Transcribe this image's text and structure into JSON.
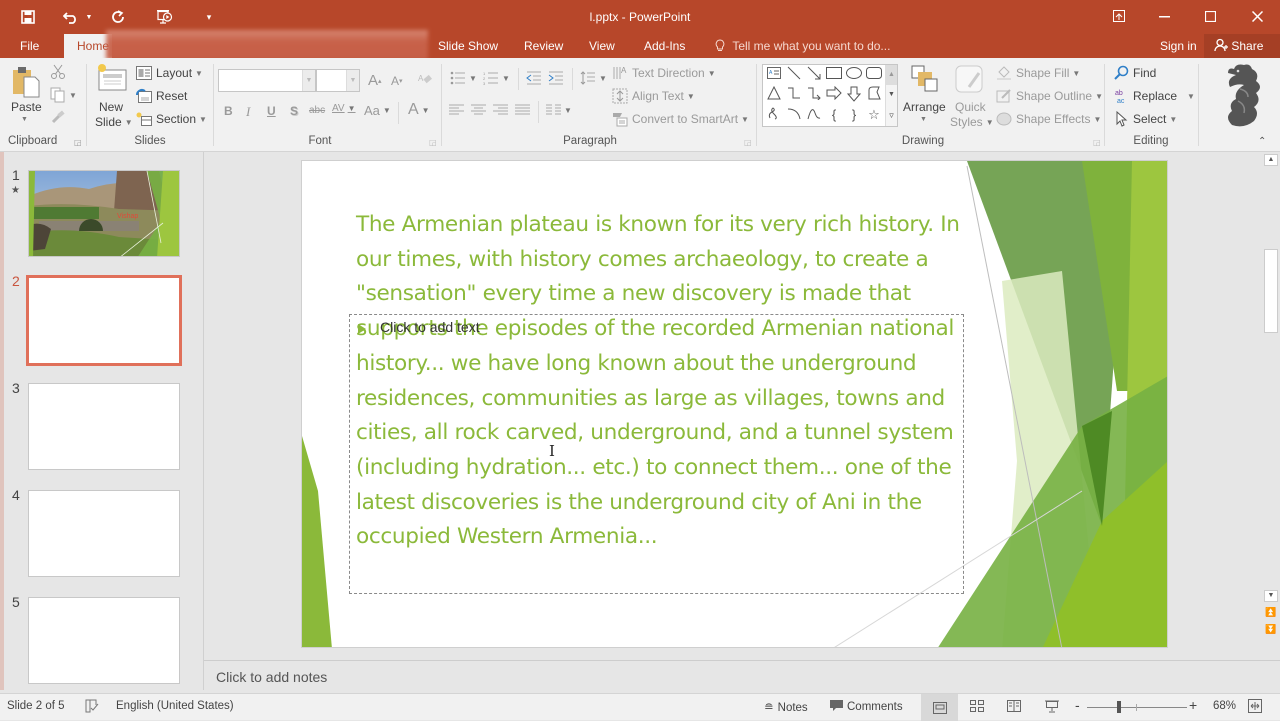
{
  "window": {
    "title": "l.pptx - PowerPoint",
    "controls": [
      "ribbon-display-options",
      "minimize",
      "maximize",
      "close"
    ]
  },
  "quick_access": {
    "items": [
      {
        "name": "save",
        "icon": "save-icon"
      },
      {
        "name": "undo",
        "icon": "undo-icon"
      },
      {
        "name": "redo",
        "icon": "redo-icon"
      },
      {
        "name": "start-from-beginning",
        "icon": "presentation-icon"
      },
      {
        "name": "customize",
        "icon": "chevron-down-icon"
      }
    ]
  },
  "tabs": [
    {
      "label": "File",
      "active": false
    },
    {
      "label": "Home",
      "active": true
    },
    {
      "label": "Slide Show",
      "active": false
    },
    {
      "label": "Review",
      "active": false
    },
    {
      "label": "View",
      "active": false
    },
    {
      "label": "Add-Ins",
      "active": false
    }
  ],
  "tell_me": "Tell me what you want to do...",
  "sign_in": "Sign in",
  "share": "Share",
  "ribbon": {
    "clipboard": {
      "label": "Clipboard",
      "paste": "Paste"
    },
    "slides": {
      "label": "Slides",
      "new_slide_1": "New",
      "new_slide_2": "Slide",
      "layout": "Layout",
      "reset": "Reset",
      "section": "Section"
    },
    "font": {
      "label": "Font",
      "font_name": "",
      "font_size": "",
      "bold": "B",
      "italic": "I",
      "underline": "U",
      "shadow": "S",
      "strike": "abc",
      "spacing": "AV",
      "case": "Aa",
      "color": "A"
    },
    "paragraph": {
      "label": "Paragraph",
      "text_direction": "Text Direction",
      "align_text": "Align Text",
      "convert_smartart": "Convert to SmartArt"
    },
    "drawing": {
      "label": "Drawing",
      "arrange": "Arrange",
      "quick_styles_1": "Quick",
      "quick_styles_2": "Styles",
      "shape_fill": "Shape Fill",
      "shape_outline": "Shape Outline",
      "shape_effects": "Shape Effects"
    },
    "editing": {
      "label": "Editing",
      "find": "Find",
      "replace": "Replace",
      "select": "Select"
    }
  },
  "thumbnails": [
    {
      "num": "1",
      "selected": false,
      "has_animation": true,
      "caption": "Vishap"
    },
    {
      "num": "2",
      "selected": true
    },
    {
      "num": "3",
      "selected": false
    },
    {
      "num": "4",
      "selected": false
    },
    {
      "num": "5",
      "selected": false
    }
  ],
  "slide": {
    "body": "The Armenian plateau is known for its very rich history. In our times, with history comes archaeology, to create a \"sensation\" every time a new discovery is made that supports the episodes of the recorded Armenian national history... we have long known about the underground residences, communities as large as villages, towns and cities, all rock carved, underground, and a tunnel system (including hydration... etc.) to connect them... one of the latest discoveries is the underground city of Ani in the occupied Western Armenia...",
    "placeholder": "Click to add text",
    "theme_colors": {
      "text": "#8bb93a",
      "dark_green": "#5e9438",
      "mid_green": "#77b043",
      "light_green": "#9dc63f",
      "pale_green": "#dcebbf"
    }
  },
  "notes": {
    "placeholder": "Click to add notes"
  },
  "status": {
    "slide_info": "Slide 2 of 5",
    "language": "English (United States)",
    "notes": "Notes",
    "comments": "Comments",
    "zoom": "68%",
    "zoom_value": 0.68
  }
}
